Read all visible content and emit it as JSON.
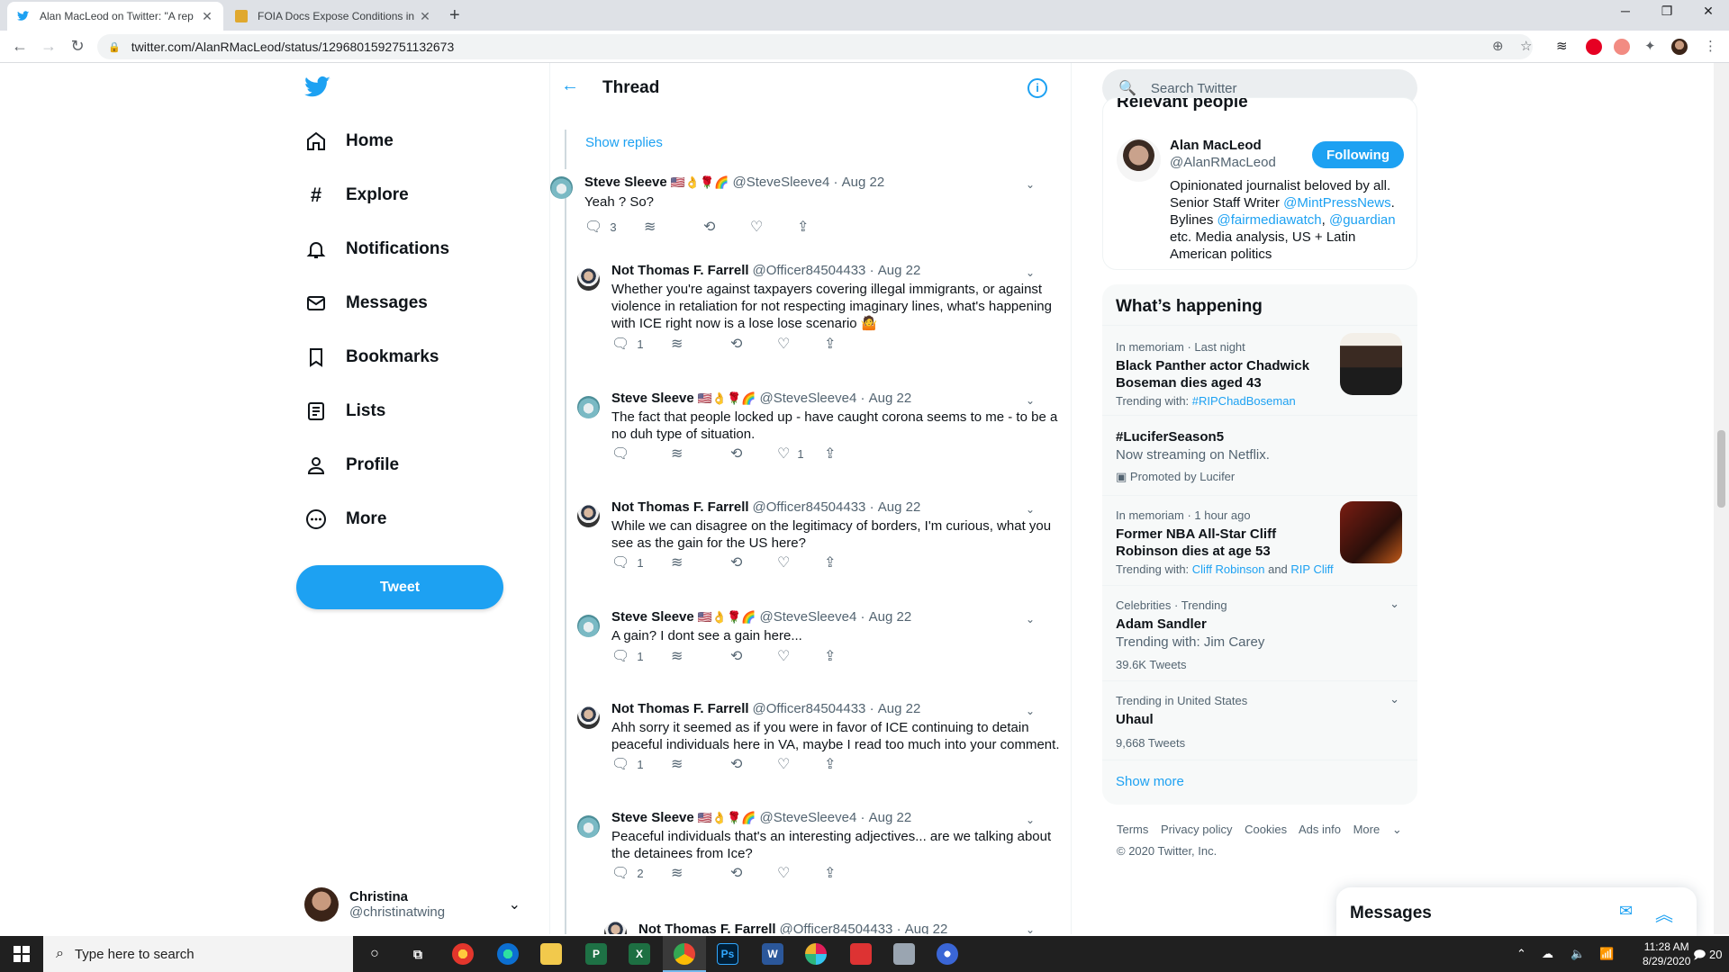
{
  "browser": {
    "tabs": [
      {
        "title": "Alan MacLeod on Twitter: \"A rep",
        "active": true
      },
      {
        "title": "FOIA Docs Expose Conditions in",
        "active": false
      }
    ],
    "url": "twitter.com/AlanRMacLeod/status/1296801592751132673"
  },
  "nav": {
    "items": [
      {
        "label": "Home",
        "icon": "home-icon",
        "glyph": "⌂"
      },
      {
        "label": "Explore",
        "icon": "hashtag-icon",
        "glyph": "#"
      },
      {
        "label": "Notifications",
        "icon": "bell-icon",
        "glyph": "🔔"
      },
      {
        "label": "Messages",
        "icon": "envelope-icon",
        "glyph": "✉"
      },
      {
        "label": "Bookmarks",
        "icon": "bookmark-icon",
        "glyph": "🔖"
      },
      {
        "label": "Lists",
        "icon": "list-icon",
        "glyph": "☰"
      },
      {
        "label": "Profile",
        "icon": "person-icon",
        "glyph": "👤"
      },
      {
        "label": "More",
        "icon": "more-circle-icon",
        "glyph": "⋯"
      }
    ],
    "tweet_button": "Tweet",
    "account": {
      "name": "Christina",
      "handle": "@christinatwing"
    }
  },
  "thread": {
    "title": "Thread",
    "show_replies": "Show replies",
    "tweets": [
      {
        "author": "Steve Sleeve",
        "emoji": "🇺🇸👌🌹🌈",
        "handle": "@SteveSleeve4",
        "date": "Aug 22",
        "text": "Yeah ? So?",
        "replies": "3",
        "likes": "",
        "avatar": "steve"
      },
      {
        "author": "Not Thomas F. Farrell",
        "emoji": "",
        "handle": "@Officer84504433",
        "date": "Aug 22",
        "text": "Whether you're against taxpayers covering illegal immigrants, or against violence in retaliation for not respecting imaginary lines, what's happening with ICE right now is a lose lose scenario 🤷",
        "replies": "1",
        "likes": "",
        "avatar": "farrell"
      },
      {
        "author": "Steve Sleeve",
        "emoji": "🇺🇸👌🌹🌈",
        "handle": "@SteveSleeve4",
        "date": "Aug 22",
        "text": "The fact that people locked up - have caught corona seems to me - to be a no duh type of situation.",
        "replies": "",
        "likes": "1",
        "avatar": "steve"
      },
      {
        "author": "Not Thomas F. Farrell",
        "emoji": "",
        "handle": "@Officer84504433",
        "date": "Aug 22",
        "text": "While we can disagree on the legitimacy of borders, I'm curious, what you see as the gain for the US here?",
        "replies": "1",
        "likes": "",
        "avatar": "farrell"
      },
      {
        "author": "Steve Sleeve",
        "emoji": "🇺🇸👌🌹🌈",
        "handle": "@SteveSleeve4",
        "date": "Aug 22",
        "text": "A gain? I dont see a gain here...",
        "replies": "1",
        "likes": "",
        "avatar": "steve"
      },
      {
        "author": "Not Thomas F. Farrell",
        "emoji": "",
        "handle": "@Officer84504433",
        "date": "Aug 22",
        "text": "Ahh sorry it seemed as if you were in favor of ICE continuing to detain peaceful individuals here in VA, maybe I read too much into your comment.",
        "replies": "1",
        "likes": "",
        "avatar": "farrell"
      },
      {
        "author": "Steve Sleeve",
        "emoji": "🇺🇸👌🌹🌈",
        "handle": "@SteveSleeve4",
        "date": "Aug 22",
        "text": "Peaceful individuals that's an interesting adjectives... are we talking about the detainees from Ice?",
        "replies": "2",
        "likes": "",
        "avatar": "steve"
      },
      {
        "author": "Not Thomas F. Farrell",
        "emoji": "",
        "handle": "@Officer84504433",
        "date": "Aug 22",
        "text": "",
        "replies": "",
        "likes": "",
        "avatar": "farrell"
      }
    ]
  },
  "sidebar": {
    "search_placeholder": "Search Twitter",
    "relevant": {
      "heading": "Relevant people",
      "name": "Alan MacLeod",
      "handle": "@AlanRMacLeod",
      "follow_label": "Following",
      "bio_1": "Opinionated journalist beloved by all. Senior Staff Writer ",
      "bio_link1": "@MintPressNews",
      "bio_2": ". Bylines ",
      "bio_link2": "@fairmediawatch",
      "bio_3": ", ",
      "bio_link3": "@guardian",
      "bio_4": " etc. Media analysis, US + Latin American politics"
    },
    "trends": {
      "title": "What’s happening",
      "items": [
        {
          "meta": "In memoriam · Last night",
          "title": "Black Panther actor Chadwick Boseman dies aged 43",
          "sub_prefix": "Trending with: ",
          "links": [
            "#RIPChadBoseman"
          ],
          "has_thumb": true
        },
        {
          "meta": "",
          "title": "#LuciferSeason5",
          "plain": "Now streaming on Netflix.",
          "promo": "Promoted by Lucifer"
        },
        {
          "meta": "In memoriam · 1 hour ago",
          "title": "Former NBA All-Star Cliff Robinson dies at age 53",
          "sub_prefix": "Trending with: ",
          "links": [
            "Cliff Robinson",
            "RIP Cliff"
          ],
          "link_joiner": " and ",
          "has_thumb": true
        },
        {
          "meta": "Celebrities · Trending",
          "title": "Adam Sandler",
          "plain": "Trending with: Jim Carey",
          "count": "39.6K Tweets"
        },
        {
          "meta": "Trending in United States",
          "title": "Uhaul",
          "count": "9,668 Tweets"
        }
      ],
      "show_more": "Show more"
    },
    "footer": {
      "links": [
        "Terms",
        "Privacy policy",
        "Cookies",
        "Ads info",
        "More"
      ],
      "copyright": "© 2020 Twitter, Inc."
    },
    "messages_title": "Messages"
  },
  "taskbar": {
    "search_placeholder": "Type here to search",
    "time": "11:28 AM",
    "date": "8/29/2020",
    "notifications": "20"
  },
  "colors": {
    "accent": "#1da1f2",
    "text": "#0f1419",
    "muted": "#536471"
  }
}
